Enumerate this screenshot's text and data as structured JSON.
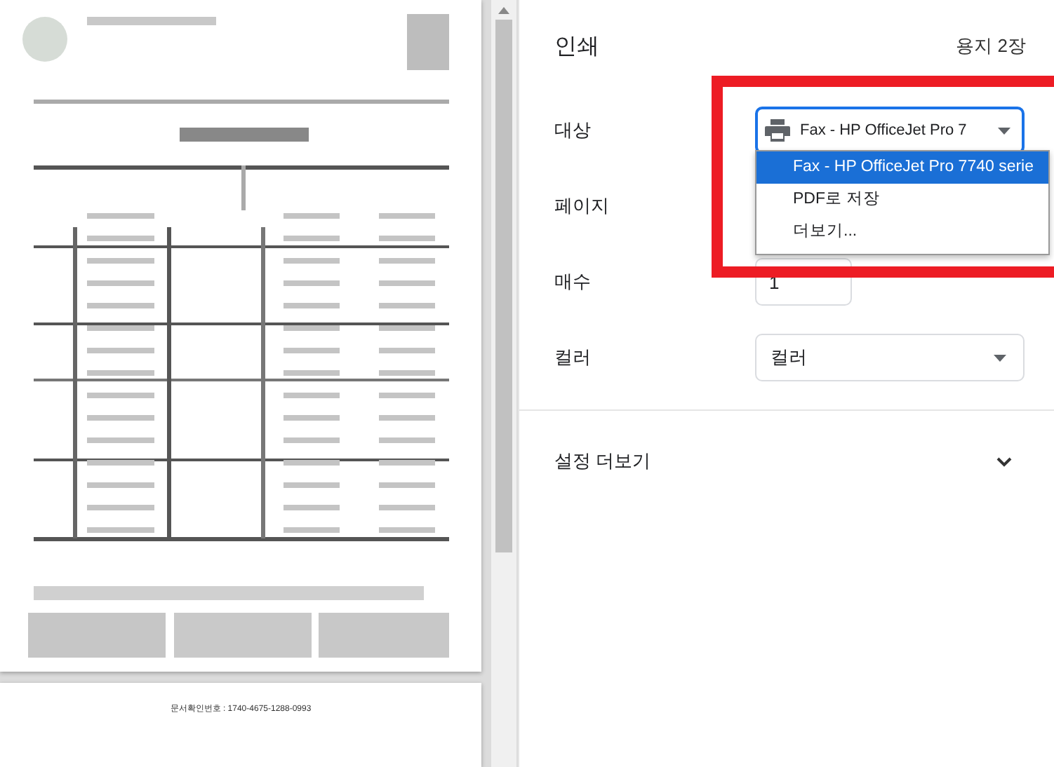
{
  "preview": {
    "document_number": "문서확인번호 : 1740-4675-1288-0993"
  },
  "settings": {
    "title": "인쇄",
    "sheets": "용지 2장",
    "rows": [
      {
        "kind": "destination",
        "label": "대상",
        "value": "Fax - HP OfficeJet Pro 7"
      },
      {
        "kind": "covered",
        "label": "페이지"
      },
      {
        "kind": "number",
        "label": "매수",
        "value": "1"
      },
      {
        "kind": "select",
        "label": "컬러",
        "value": "컬러"
      }
    ],
    "dropdown": {
      "options": [
        {
          "label": "Fax - HP OfficeJet Pro 7740 serie",
          "selected": true
        },
        {
          "label": "PDF로 저장",
          "selected": false
        },
        {
          "label": "더보기...",
          "selected": false
        }
      ]
    },
    "more_settings": {
      "label": "설정 더보기",
      "expanded": false
    }
  }
}
